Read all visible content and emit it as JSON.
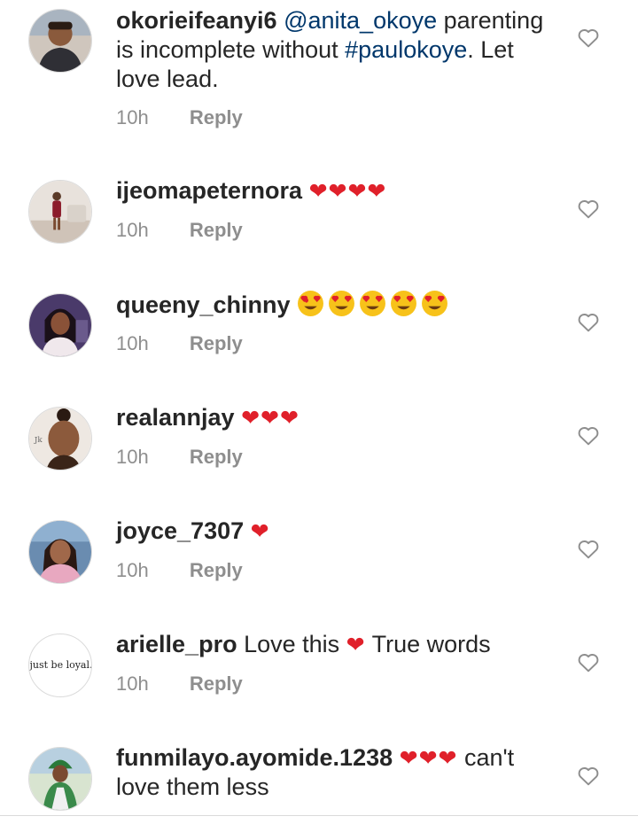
{
  "comments": [
    {
      "username": "okorieifeanyi6",
      "mention": "@anita_okoye",
      "text_a": " parenting is incomplete without ",
      "hashtag": "#paulokoye",
      "text_b": ". Let love lead.",
      "time": "10h",
      "reply_label": "Reply",
      "avatar_icon": "avatar-man-photo"
    },
    {
      "username": "ijeomapeternora",
      "emojis": "❤❤❤❤",
      "time": "10h",
      "reply_label": "Reply",
      "avatar_icon": "avatar-woman-room-photo"
    },
    {
      "username": "queeny_chinny",
      "emoji_name": "heart-eyes-emoji",
      "emoji_count": 5,
      "time": "10h",
      "reply_label": "Reply",
      "avatar_icon": "avatar-woman-purple-photo"
    },
    {
      "username": "realannjay",
      "emojis": "❤❤❤",
      "time": "10h",
      "reply_label": "Reply",
      "avatar_icon": "avatar-woman-portrait-photo"
    },
    {
      "username": "joyce_7307",
      "emojis": "❤",
      "time": "10h",
      "reply_label": "Reply",
      "avatar_icon": "avatar-woman-pink-photo"
    },
    {
      "username": "arielle_pro",
      "text_a": " Love this ",
      "emojis": "❤",
      "text_b": " True words",
      "time": "10h",
      "reply_label": "Reply",
      "avatar_text": "just be loyal."
    },
    {
      "username": "funmilayo.ayomide.1238",
      "emojis": "❤❤❤",
      "text_a": " can't love them less",
      "avatar_icon": "avatar-woman-outdoor-photo"
    }
  ],
  "colors": {
    "username": "#262626",
    "link": "#00376b",
    "meta": "#8e8e8e",
    "heart": "#e0202a"
  }
}
